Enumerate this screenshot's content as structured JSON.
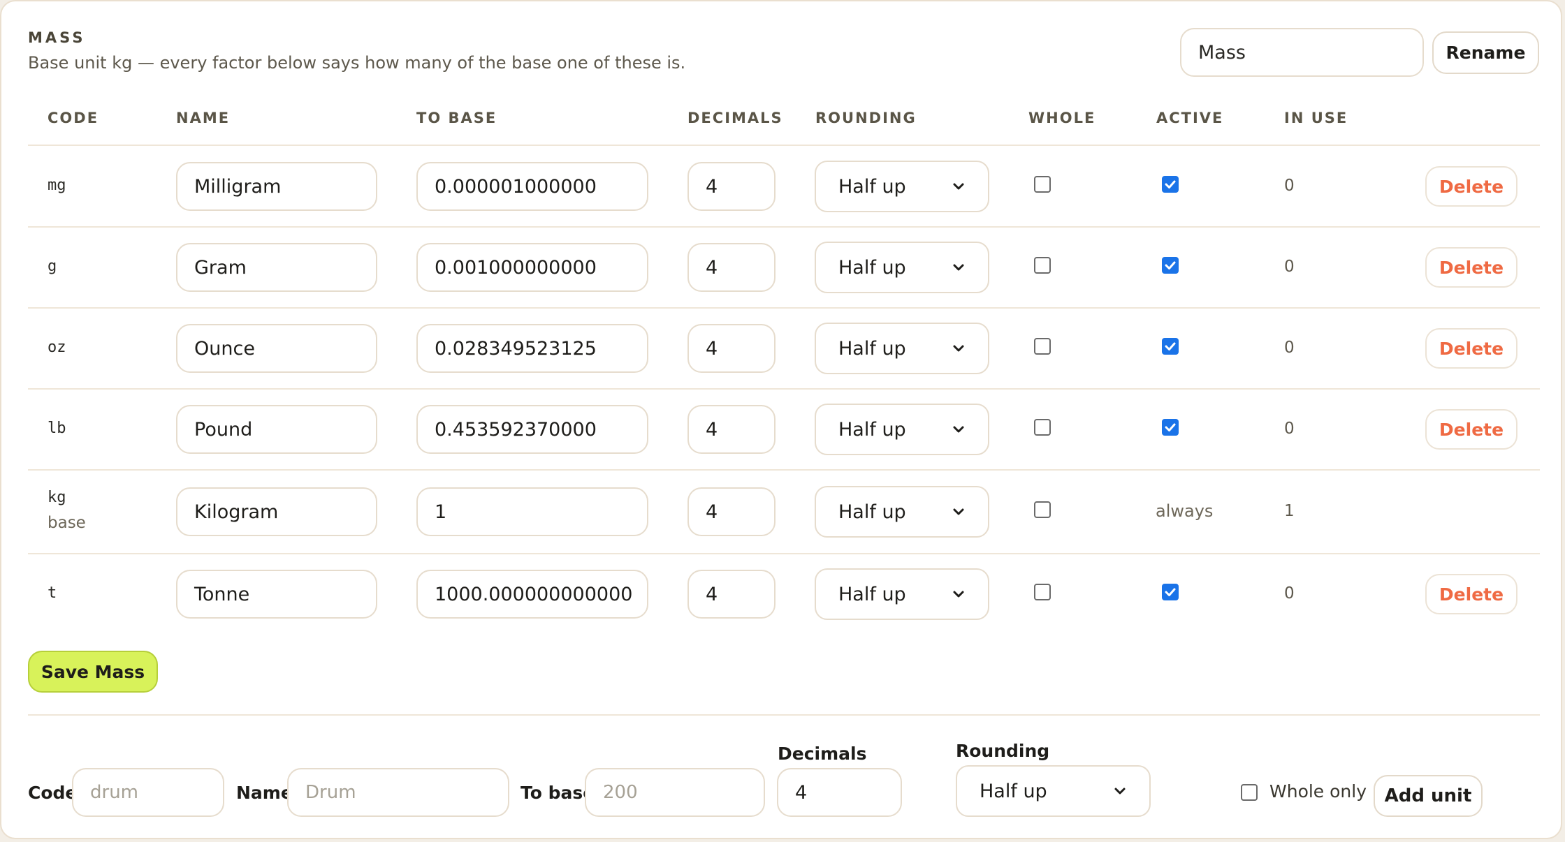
{
  "section": {
    "title": "MASS",
    "subtitle": "Base unit kg — every factor below says how many of the base one of these is.",
    "rename_value": "Mass",
    "rename_label": "Rename"
  },
  "columns": {
    "code": "CODE",
    "name": "NAME",
    "to_base": "TO BASE",
    "decimals": "DECIMALS",
    "rounding": "ROUNDING",
    "whole": "WHOLE",
    "active": "ACTIVE",
    "in_use": "IN USE"
  },
  "rows": [
    {
      "code": "mg",
      "name": "Milligram",
      "to_base": "0.000001000000",
      "decimals": "4",
      "rounding": "Half up",
      "whole": false,
      "active": true,
      "in_use": "0",
      "delete_label": "Delete"
    },
    {
      "code": "g",
      "name": "Gram",
      "to_base": "0.001000000000",
      "decimals": "4",
      "rounding": "Half up",
      "whole": false,
      "active": true,
      "in_use": "0",
      "delete_label": "Delete"
    },
    {
      "code": "oz",
      "name": "Ounce",
      "to_base": "0.028349523125",
      "decimals": "4",
      "rounding": "Half up",
      "whole": false,
      "active": true,
      "in_use": "0",
      "delete_label": "Delete"
    },
    {
      "code": "lb",
      "name": "Pound",
      "to_base": "0.453592370000",
      "decimals": "4",
      "rounding": "Half up",
      "whole": false,
      "active": true,
      "in_use": "0",
      "delete_label": "Delete"
    },
    {
      "code": "kg",
      "base_tag": "base",
      "name": "Kilogram",
      "to_base": "1",
      "decimals": "4",
      "rounding": "Half up",
      "whole": false,
      "active_text": "always",
      "in_use": "1"
    },
    {
      "code": "t",
      "name": "Tonne",
      "to_base": "1000.000000000000",
      "decimals": "4",
      "rounding": "Half up",
      "whole": false,
      "active": true,
      "in_use": "0",
      "delete_label": "Delete"
    }
  ],
  "save_label": "Save Mass",
  "add_form": {
    "code_label": "Code",
    "code_placeholder": "drum",
    "name_label": "Name",
    "name_placeholder": "Drum",
    "to_base_label": "To base",
    "to_base_placeholder": "200",
    "decimals_label": "Decimals",
    "decimals_value": "4",
    "rounding_label": "Rounding",
    "rounding_value": "Half up",
    "whole_only_label": "Whole only",
    "whole_only_checked": false,
    "add_label": "Add unit"
  },
  "icons": {
    "select_arrow": "chevron-down-icon",
    "checkbox_checked": "checkmark-icon"
  },
  "colors": {
    "accent_save": "#d8f25a",
    "delete_text": "#ef6a43",
    "checkbox_checked": "#1a73e8"
  }
}
